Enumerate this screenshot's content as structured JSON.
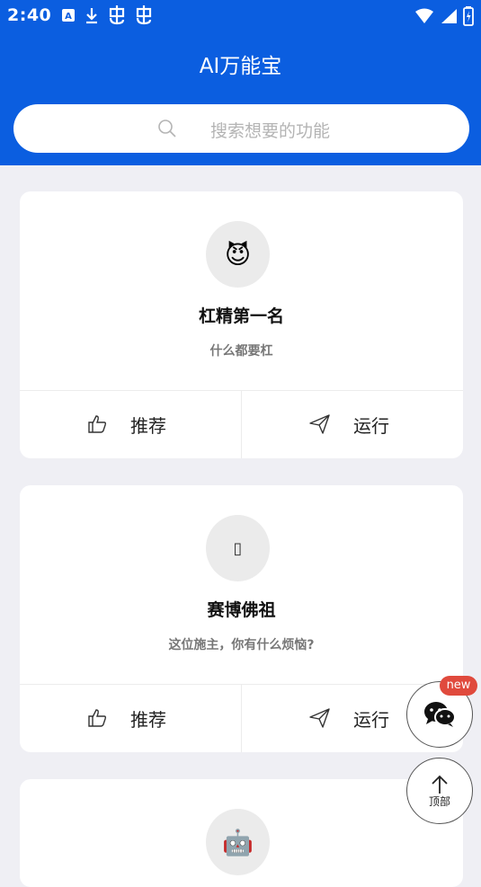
{
  "status_bar": {
    "time": "2:40",
    "left_icons": [
      "accessibility-icon",
      "download-icon",
      "bug-icon",
      "bug-icon"
    ],
    "right_icons": [
      "wifi-icon",
      "signal-icon",
      "battery-icon"
    ]
  },
  "header": {
    "title": "AI万能宝",
    "search_placeholder": "搜索想要的功能",
    "color": "#0b5ee0"
  },
  "cards": [
    {
      "avatar_emoji": "😈",
      "name": "杠精第一名",
      "description": "什么都要杠",
      "recommend_label": "推荐",
      "run_label": "运行"
    },
    {
      "avatar_emoji": "▯",
      "name": "赛博佛祖",
      "description": "这位施主，你有什么烦恼?",
      "recommend_label": "推荐",
      "run_label": "运行"
    },
    {
      "avatar_emoji": "🤖",
      "name": "",
      "description": ""
    }
  ],
  "floating": {
    "new_badge": "new",
    "top_label": "顶部"
  }
}
